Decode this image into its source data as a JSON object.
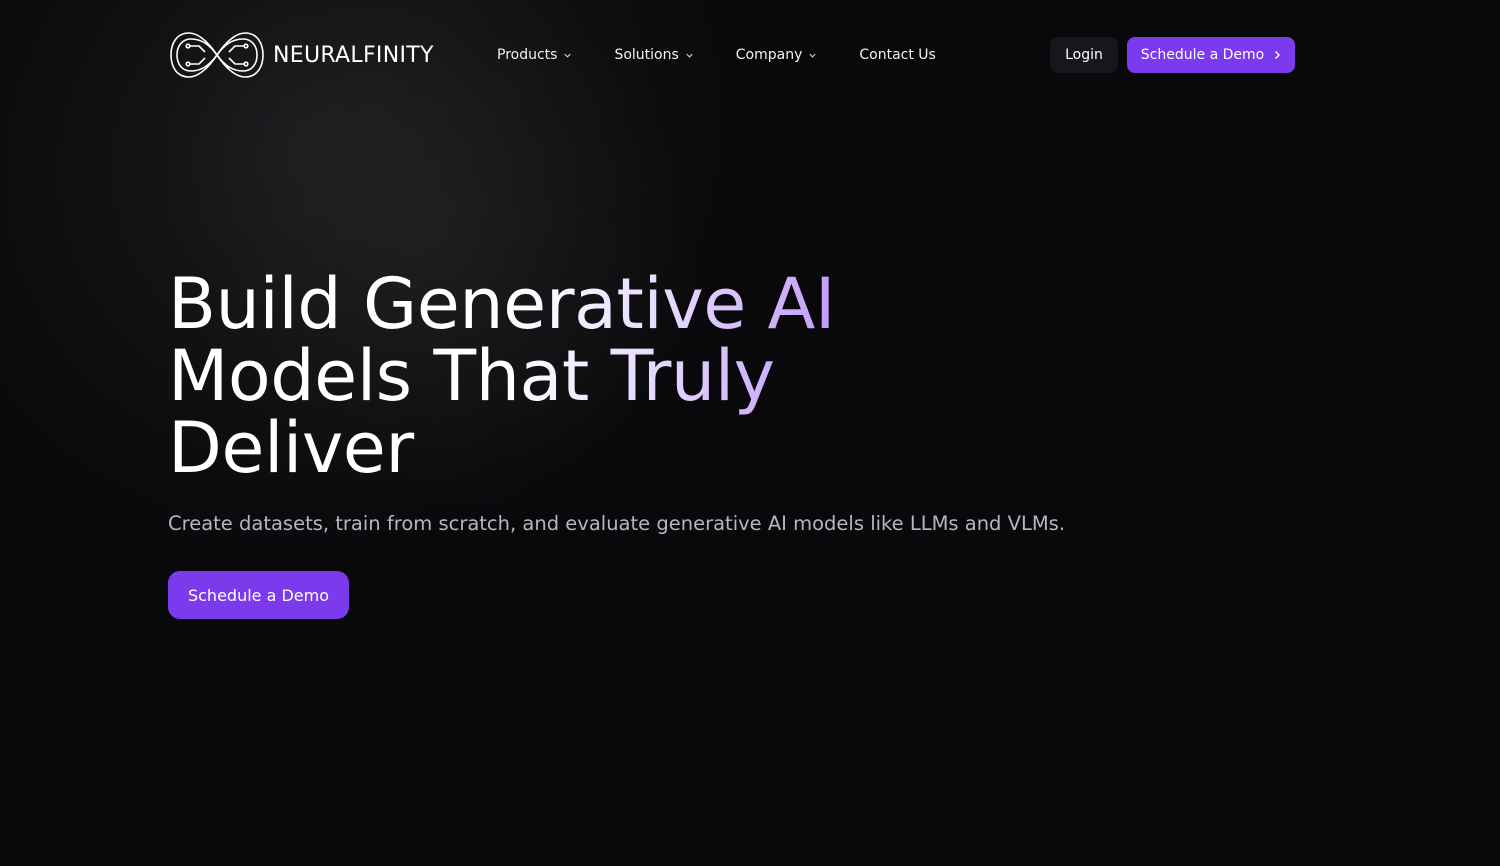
{
  "brand": {
    "name": "NEURALFINITY",
    "logo_icon": "infinity-circuit-icon"
  },
  "nav": {
    "items": [
      {
        "label": "Products",
        "has_dropdown": true
      },
      {
        "label": "Solutions",
        "has_dropdown": true
      },
      {
        "label": "Company",
        "has_dropdown": true
      },
      {
        "label": "Contact Us",
        "has_dropdown": false
      }
    ],
    "login_label": "Login",
    "demo_label": "Schedule a Demo"
  },
  "hero": {
    "title_lines": [
      "Build Generative AI",
      "Models That Truly",
      "Deliver"
    ],
    "subtitle": "Create datasets, train from scratch, and evaluate generative AI models like LLMs and VLMs.",
    "cta_label": "Schedule a Demo"
  },
  "colors": {
    "background": "#09090c",
    "accent": "#7c3aed",
    "gradient_end": "#a66ff0",
    "subtitle": "#b6b6c0"
  }
}
